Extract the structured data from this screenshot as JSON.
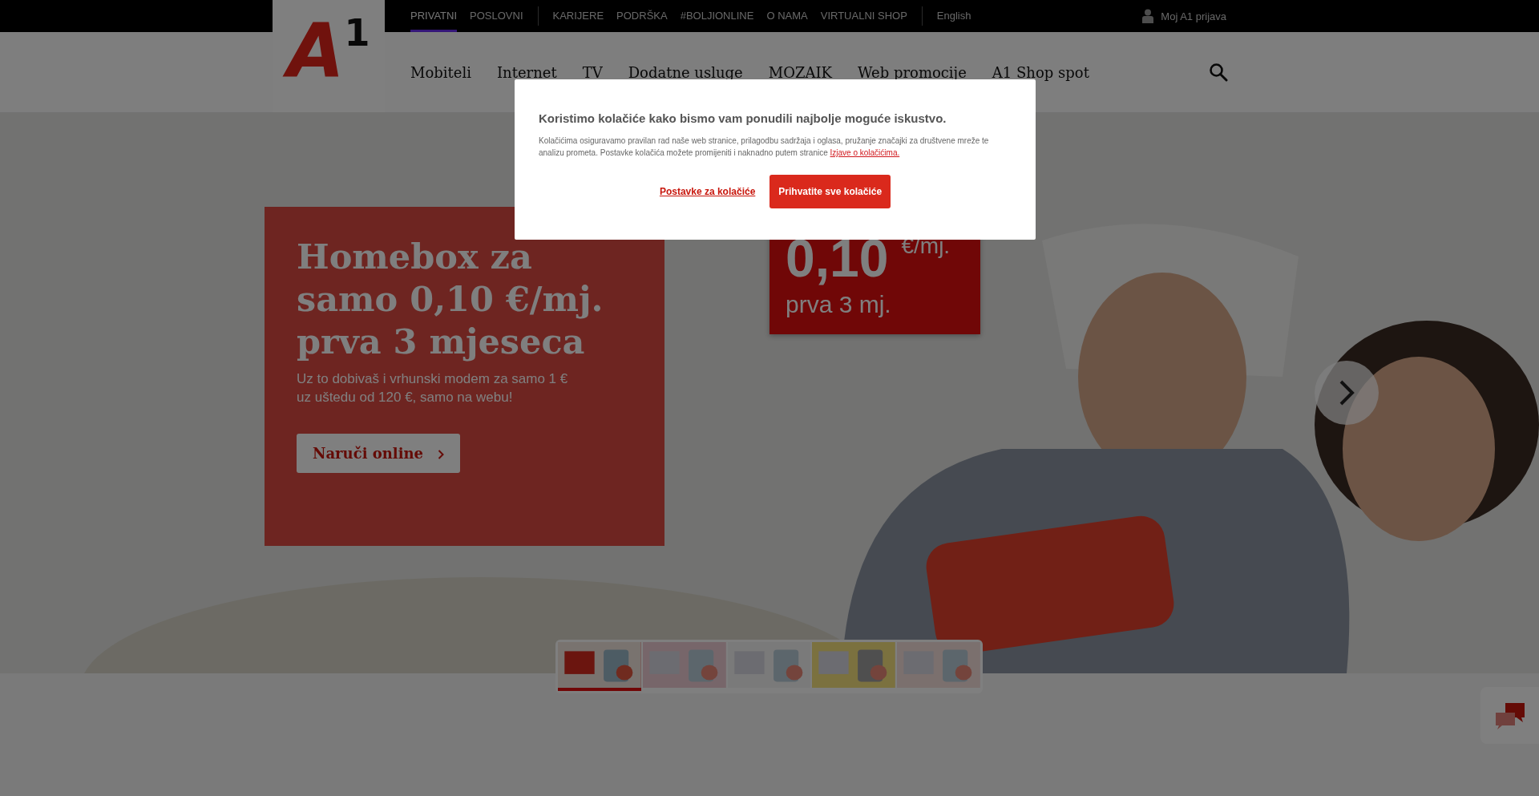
{
  "top_bar": {
    "segments": [
      {
        "label": "PRIVATNI",
        "selected": true
      },
      {
        "label": "POSLOVNI",
        "selected": false
      }
    ],
    "links": [
      "KARIJERE",
      "PODRŠKA",
      "#BOLJIONLINE",
      "O NAMA",
      "VIRTUALNI SHOP"
    ],
    "language": "English",
    "login": "Moj A1 prijava"
  },
  "header": {
    "logo": {
      "letter": "A",
      "superscript": "1"
    },
    "nav": [
      "Mobiteli",
      "Internet",
      "TV",
      "Dodatne usluge",
      "MOZAIK",
      "Web promocije",
      "A1 Shop spot"
    ]
  },
  "hero": {
    "headline": "Homebox za samo 0,10 €/mj. prva 3 mjeseca",
    "subtext": "Uz to dobivaš i vrhunski modem za samo 1 € uz uštedu od 120 €, samo na webu!",
    "cta": "Naruči online",
    "price_badge": {
      "price": "0,10",
      "unit": "€/mj.",
      "period": "prva 3 mj."
    },
    "thumbnails": [
      {
        "kind": "picture",
        "selected": true
      },
      {
        "kind": "picture",
        "selected": false
      },
      {
        "kind": "picture",
        "selected": false
      },
      {
        "kind": "picture",
        "selected": false
      },
      {
        "kind": "picture",
        "selected": false
      }
    ]
  },
  "cookie_dialog": {
    "title": "Koristimo kolačiće kako bismo vam ponudili najbolje moguće iskustvo.",
    "text": "Kolačićima osiguravamo pravilan rad naše web stranice, prilagodbu sadržaja i oglasa, pružanje značajki za društvene mreže te analizu prometa. Postavke kolačića možete promijeniti i naknadno putem stranice",
    "link": "Izjave o kolačićima.",
    "settings_link": "Postavke za kolačiće",
    "accept_button": "Prihvatite sve kolačiće"
  }
}
